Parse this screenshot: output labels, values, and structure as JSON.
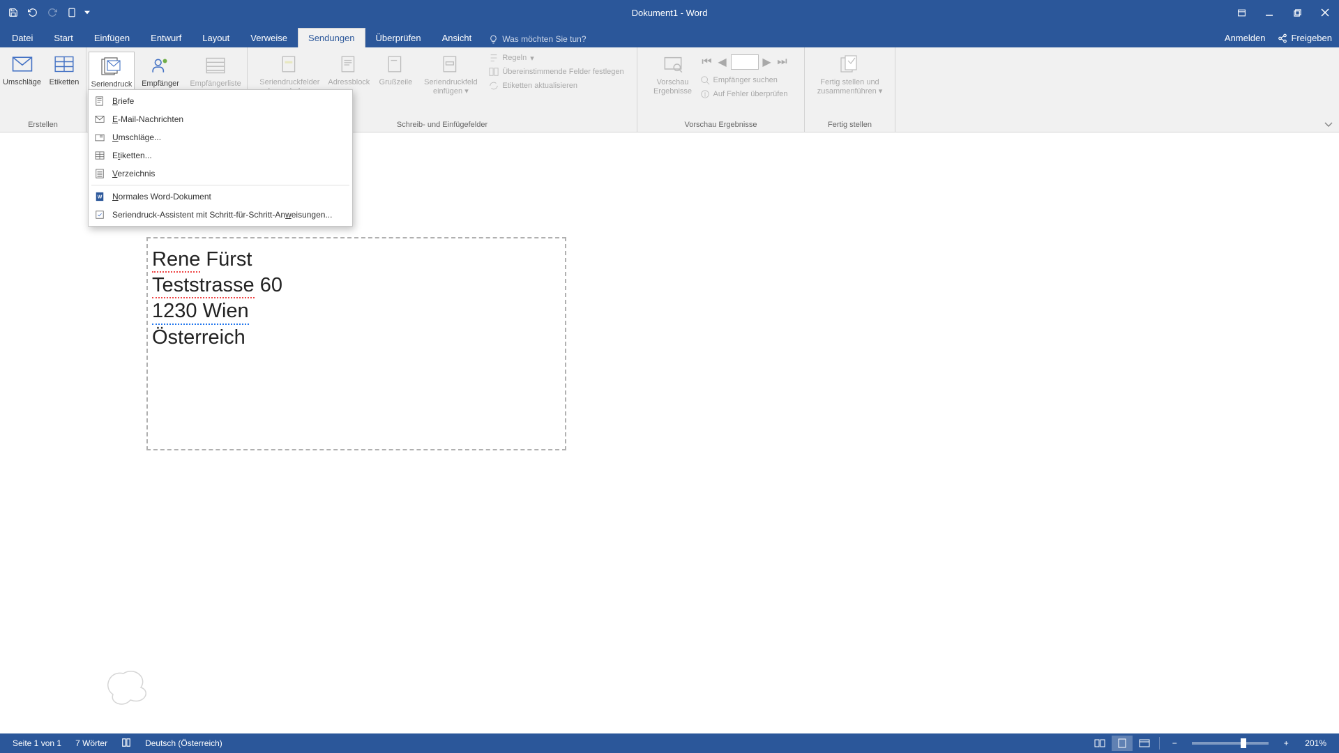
{
  "app": {
    "title": "Dokument1 - Word"
  },
  "tabs": {
    "datei": "Datei",
    "start": "Start",
    "einfuegen": "Einfügen",
    "entwurf": "Entwurf",
    "layout": "Layout",
    "verweise": "Verweise",
    "sendungen": "Sendungen",
    "ueberpruefen": "Überprüfen",
    "ansicht": "Ansicht"
  },
  "tellme": "Was möchten Sie tun?",
  "rightlinks": {
    "anmelden": "Anmelden",
    "freigeben": "Freigeben"
  },
  "ribbon": {
    "erstellen": {
      "umschlaege": "Umschläge",
      "etiketten": "Etiketten",
      "label": "Erstellen"
    },
    "seriendruck": {
      "starten": "Seriendruck starten",
      "empfaenger": "Empfänger auswählen",
      "liste": "Empfängerliste bearbeiten"
    },
    "felder": {
      "hervorheben": "Seriendruckfelder hervorheben",
      "adressblock": "Adressblock",
      "grusszeile": "Grußzeile",
      "einfuegen": "Seriendruckfeld einfügen",
      "regeln": "Regeln",
      "uebereinstimmen": "Übereinstimmende Felder festlegen",
      "aktualisieren": "Etiketten aktualisieren",
      "label": "Schreib- und Einfügefelder"
    },
    "vorschau": {
      "btn": "Vorschau Ergebnisse",
      "suchen": "Empfänger suchen",
      "fehler": "Auf Fehler überprüfen",
      "label": "Vorschau Ergebnisse"
    },
    "fertig": {
      "btn": "Fertig stellen und zusammenführen",
      "label": "Fertig stellen"
    }
  },
  "dropdown": {
    "briefe": "Briefe",
    "email": "E-Mail-Nachrichten",
    "umschlaege": "Umschläge...",
    "etiketten": "Etiketten...",
    "verzeichnis": "Verzeichnis",
    "normales": "Normales Word-Dokument",
    "assistent": "Seriendruck-Assistent mit Schritt-für-Schritt-Anweisungen..."
  },
  "document": {
    "lines": {
      "l1a": "Rene",
      "l1b": " Fürst",
      "l2a": "Teststrasse",
      "l2b": " 60",
      "l3": "1230 Wien",
      "l4": "Österreich"
    }
  },
  "statusbar": {
    "page": "Seite 1 von 1",
    "words": "7 Wörter",
    "lang": "Deutsch (Österreich)",
    "zoom": "201%"
  }
}
